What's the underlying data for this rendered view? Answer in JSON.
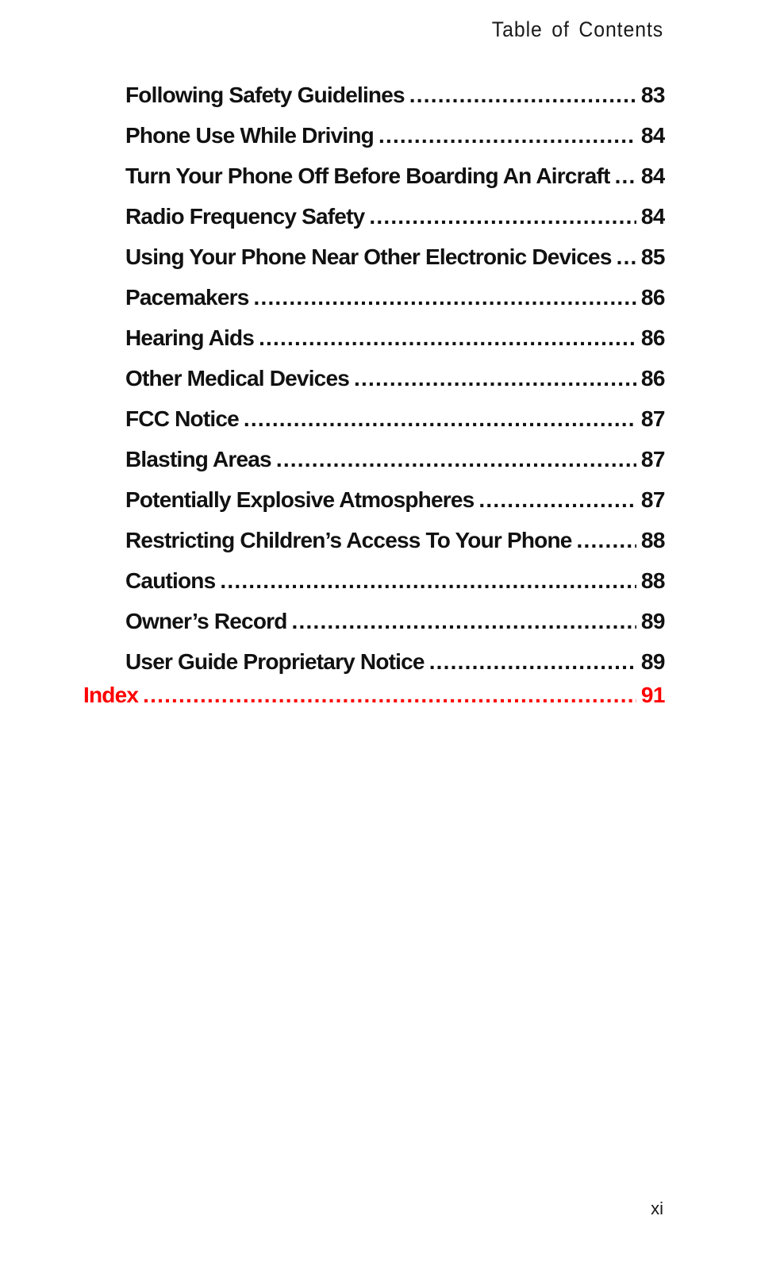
{
  "header": {
    "title": "Table of Contents"
  },
  "toc": {
    "entries": [
      {
        "title": "Following Safety Guidelines",
        "page": "83",
        "level": "sub"
      },
      {
        "title": "Phone Use While Driving",
        "page": "84",
        "level": "sub"
      },
      {
        "title": "Turn Your Phone Off Before Boarding An Aircraft",
        "page": "84",
        "level": "sub"
      },
      {
        "title": "Radio Frequency Safety",
        "page": "84",
        "level": "sub"
      },
      {
        "title": "Using Your Phone Near Other Electronic Devices",
        "page": "85",
        "level": "sub"
      },
      {
        "title": "Pacemakers",
        "page": "86",
        "level": "sub"
      },
      {
        "title": "Hearing Aids",
        "page": "86",
        "level": "sub"
      },
      {
        "title": "Other Medical Devices",
        "page": "86",
        "level": "sub"
      },
      {
        "title": "FCC Notice",
        "page": "87",
        "level": "sub"
      },
      {
        "title": "Blasting Areas",
        "page": "87",
        "level": "sub"
      },
      {
        "title": "Potentially Explosive Atmospheres",
        "page": "87",
        "level": "sub"
      },
      {
        "title": "Restricting Children’s Access To Your Phone",
        "page": "88",
        "level": "sub"
      },
      {
        "title": "Cautions",
        "page": "88",
        "level": "sub"
      },
      {
        "title": "Owner’s Record",
        "page": "89",
        "level": "sub"
      },
      {
        "title": "User Guide Proprietary Notice",
        "page": "89",
        "level": "sub"
      },
      {
        "title": "Index",
        "page": "91",
        "level": "main"
      }
    ]
  },
  "colors": {
    "text": "#111111",
    "accent": "#ff0000"
  },
  "footer": {
    "page_number": "xi"
  }
}
